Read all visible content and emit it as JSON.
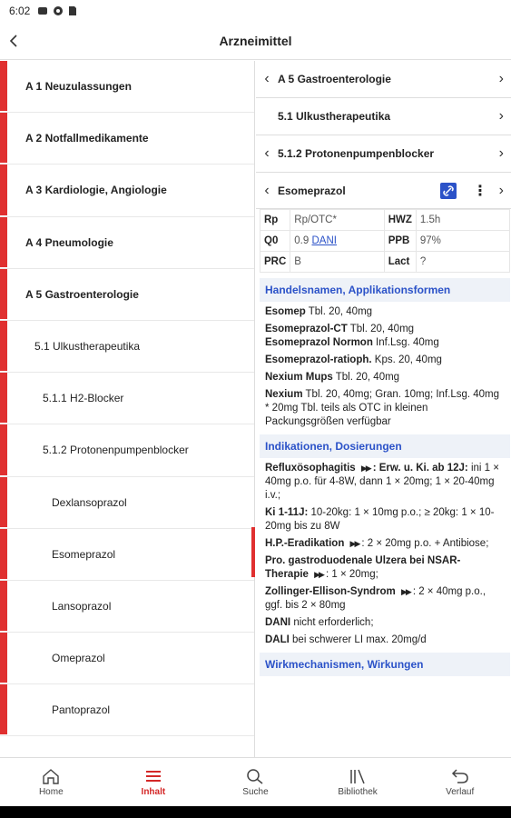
{
  "status": {
    "time": "6:02"
  },
  "appbar": {
    "title": "Arzneimittel"
  },
  "left_list": [
    {
      "label": "A 1 Neuzulassungen",
      "bold": true,
      "indent": 0
    },
    {
      "label": "A 2 Notfallmedikamente",
      "bold": true,
      "indent": 0
    },
    {
      "label": "A 3 Kardiologie, Angiologie",
      "bold": true,
      "indent": 0
    },
    {
      "label": "A 4 Pneumologie",
      "bold": true,
      "indent": 0
    },
    {
      "label": "A 5 Gastroenterologie",
      "bold": true,
      "indent": 0
    },
    {
      "label": "5.1 Ulkustherapeutika",
      "bold": false,
      "indent": 1
    },
    {
      "label": "5.1.1 H2-Blocker",
      "bold": false,
      "indent": 2
    },
    {
      "label": "5.1.2 Protonenpumpenblocker",
      "bold": false,
      "indent": 2
    },
    {
      "label": "Dexlansoprazol",
      "bold": false,
      "indent": 3
    },
    {
      "label": "Esomeprazol",
      "bold": false,
      "indent": 3
    },
    {
      "label": "Lansoprazol",
      "bold": false,
      "indent": 3
    },
    {
      "label": "Omeprazol",
      "bold": false,
      "indent": 3
    },
    {
      "label": "Pantoprazol",
      "bold": false,
      "indent": 3
    }
  ],
  "right": {
    "nav": [
      {
        "label": "A 5 Gastroenterologie"
      },
      {
        "label": "5.1 Ulkustherapeutika"
      },
      {
        "label": "5.1.2 Protonenpumpenblocker"
      }
    ],
    "drug": "Esomeprazol",
    "facts": {
      "rp_k": "Rp",
      "rp_v": "Rp/OTC*",
      "hwz_k": "HWZ",
      "hwz_v": "1.5h",
      "qo_k": "Q0",
      "qo_v": "0.9",
      "dani": "DANI",
      "ppb_k": "PPB",
      "ppb_v": "97%",
      "prc_k": "PRC",
      "prc_v": "B",
      "lact_k": "Lact",
      "lact_v": "?"
    },
    "sec1": "Handelsnamen, Applikationsformen",
    "h1b": "Esomep",
    "h1": " Tbl. 20, 40mg",
    "h2b": "Esomeprazol-CT",
    "h2": " Tbl. 20, 40mg",
    "h2cb": "Esomeprazol Normon",
    "h2c": " Inf.Lsg. 40mg",
    "h3b": "Esomeprazol-ratioph.",
    "h3": " Kps. 20, 40mg",
    "h4b": "Nexium Mups",
    "h4": " Tbl. 20, 40mg",
    "h5b": "Nexium",
    "h5": " Tbl. 20, 40mg; Gran. 10mg; Inf.Lsg. 40mg",
    "h5n": "* 20mg Tbl. teils als OTC in kleinen Packungsgrößen verfügbar",
    "sec2": "Indikationen, Dosierungen",
    "i1b": "Refluxösophagitis",
    "i1b2": ": Erw. u. Ki. ab 12J:",
    "i1": " ini 1 × 40mg p.o. für 4-8W, dann 1 × 20mg; 1 × 20-40mg i.v.;",
    "i2b": "Ki 1-11J:",
    "i2": " 10-20kg: 1 × 10mg p.o.; ≥ 20kg: 1 × 10-20mg bis zu 8W",
    "i3b": "H.P.-Eradikation",
    "i3": ": 2 × 20mg p.o. + Antibiose;",
    "i4b": "Pro. gastroduodenale Ulzera bei NSAR-Therapie",
    "i4": ": 1 × 20mg;",
    "i5b": "Zollinger-Ellison-Syndrom",
    "i5": ": 2 × 40mg p.o., ggf. bis 2 × 80mg",
    "i6b": "DANI",
    "i6": " nicht erforderlich;",
    "i7b": "DALI",
    "i7": " bei schwerer LI max. 20mg/d",
    "sec3": "Wirkmechanismen, Wirkungen"
  },
  "tabs": [
    {
      "label": "Home",
      "icon": "home-icon"
    },
    {
      "label": "Inhalt",
      "icon": "menu-icon"
    },
    {
      "label": "Suche",
      "icon": "search-icon"
    },
    {
      "label": "Bibliothek",
      "icon": "library-icon"
    },
    {
      "label": "Verlauf",
      "icon": "history-icon"
    }
  ],
  "colors": {
    "accent": "#e03030",
    "link": "#2b52c8"
  }
}
